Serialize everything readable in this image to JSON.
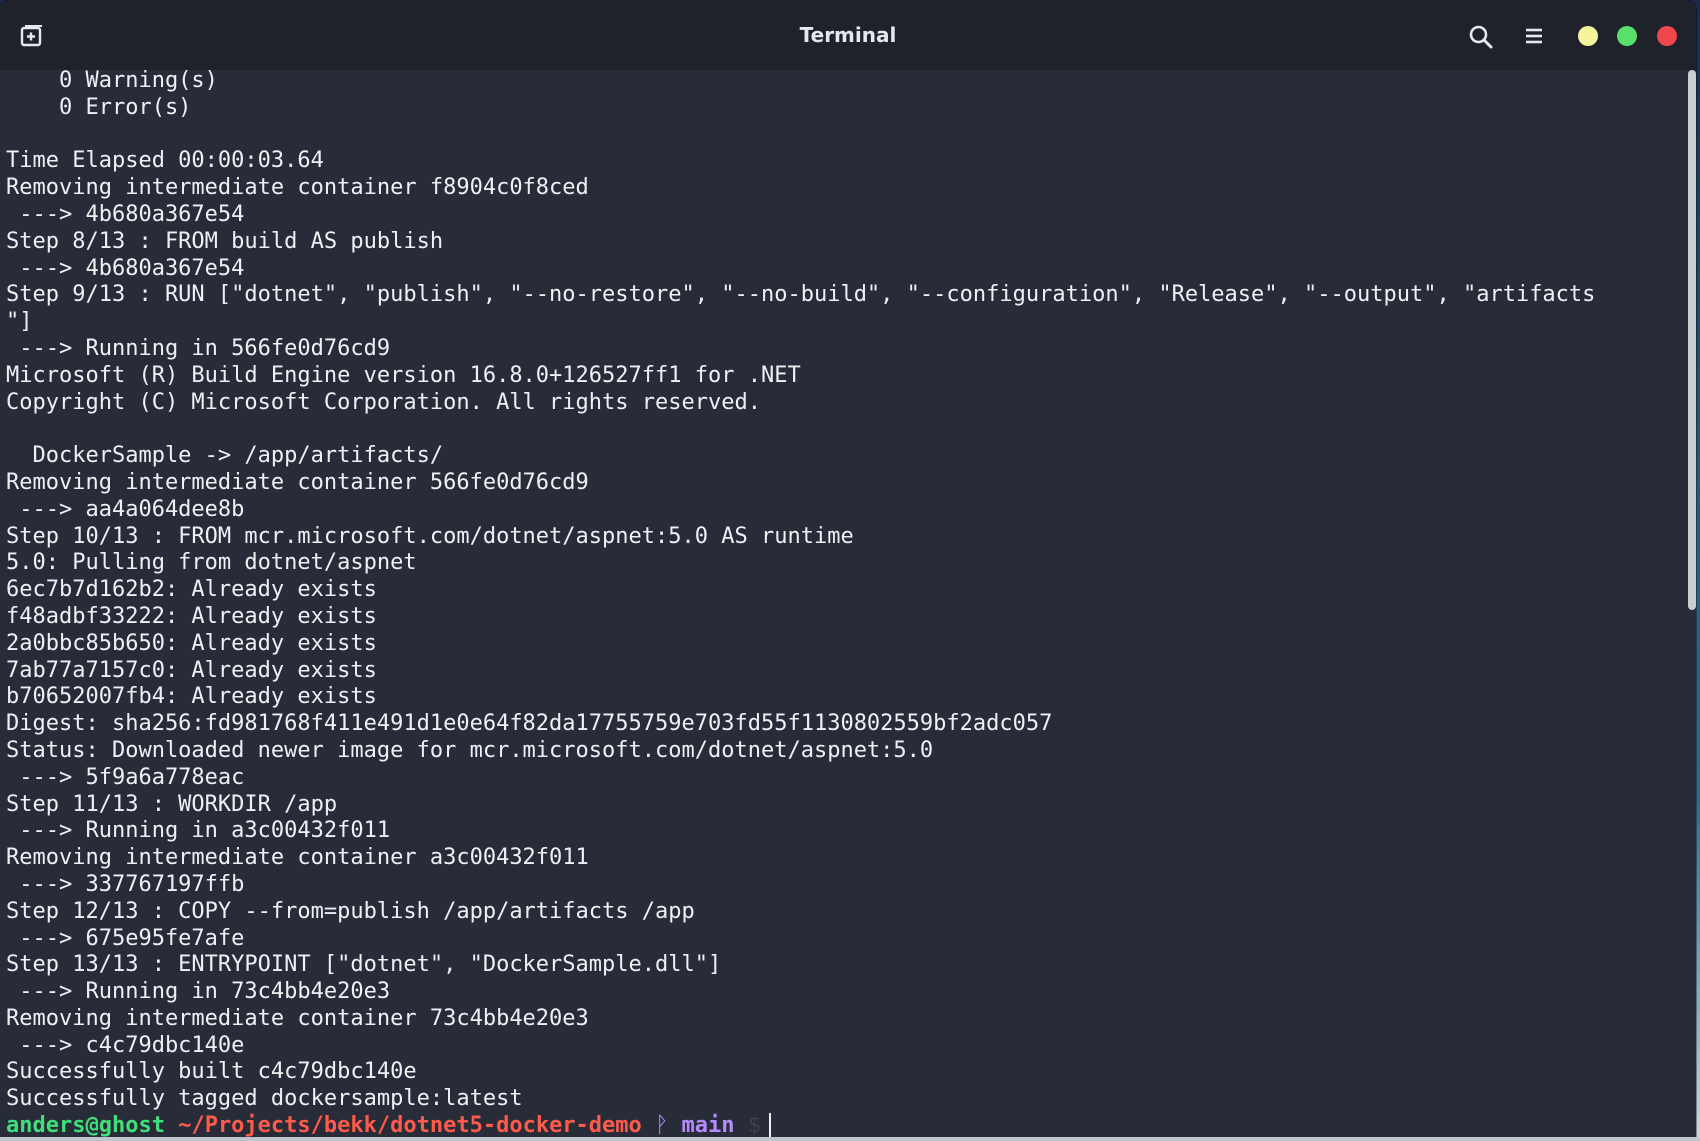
{
  "window": {
    "title": "Terminal"
  },
  "terminal": {
    "lines": [
      "    0 Warning(s)",
      "    0 Error(s)",
      "",
      "Time Elapsed 00:00:03.64",
      "Removing intermediate container f8904c0f8ced",
      " ---> 4b680a367e54",
      "Step 8/13 : FROM build AS publish",
      " ---> 4b680a367e54",
      "Step 9/13 : RUN [\"dotnet\", \"publish\", \"--no-restore\", \"--no-build\", \"--configuration\", \"Release\", \"--output\", \"artifacts",
      "\"]",
      " ---> Running in 566fe0d76cd9",
      "Microsoft (R) Build Engine version 16.8.0+126527ff1 for .NET",
      "Copyright (C) Microsoft Corporation. All rights reserved.",
      "",
      "  DockerSample -> /app/artifacts/",
      "Removing intermediate container 566fe0d76cd9",
      " ---> aa4a064dee8b",
      "Step 10/13 : FROM mcr.microsoft.com/dotnet/aspnet:5.0 AS runtime",
      "5.0: Pulling from dotnet/aspnet",
      "6ec7b7d162b2: Already exists",
      "f48adbf33222: Already exists",
      "2a0bbc85b650: Already exists",
      "7ab77a7157c0: Already exists",
      "b70652007fb4: Already exists",
      "Digest: sha256:fd981768f411e491d1e0e64f82da17755759e703fd55f1130802559bf2adc057",
      "Status: Downloaded newer image for mcr.microsoft.com/dotnet/aspnet:5.0",
      " ---> 5f9a6a778eac",
      "Step 11/13 : WORKDIR /app",
      " ---> Running in a3c00432f011",
      "Removing intermediate container a3c00432f011",
      " ---> 337767197ffb",
      "Step 12/13 : COPY --from=publish /app/artifacts /app",
      " ---> 675e95fe7afe",
      "Step 13/13 : ENTRYPOINT [\"dotnet\", \"DockerSample.dll\"]",
      " ---> Running in 73c4bb4e20e3",
      "Removing intermediate container 73c4bb4e20e3",
      " ---> c4c79dbc140e",
      "Successfully built c4c79dbc140e",
      "Successfully tagged dockersample:latest"
    ],
    "prompt": {
      "user_host": "anders@ghost",
      "path": "~/Projects/bekk/dotnet5-docker-demo",
      "branch_icon": "ᚹ",
      "branch": "main",
      "symbol": "$"
    }
  },
  "colors": {
    "background": "#282c38",
    "titlebar": "#1f222b",
    "text": "#eef0f4",
    "prompt_user": "#3fe07a",
    "prompt_path": "#ff5a4a",
    "prompt_branch": "#b48cff",
    "minimize": "#f5f49a",
    "maximize": "#58e06a",
    "close": "#f0474f"
  },
  "icons": {
    "new_tab": "new-tab-icon",
    "search": "search-icon",
    "menu": "hamburger-menu-icon"
  }
}
